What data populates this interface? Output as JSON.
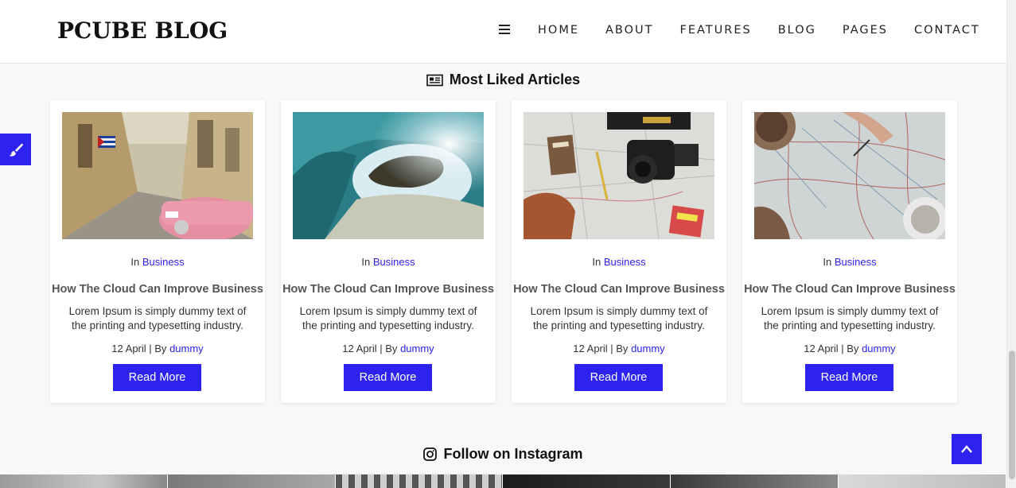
{
  "header": {
    "logo": "PCUBE BLOG",
    "nav": [
      "HOME",
      "ABOUT",
      "FEATURES",
      "BLOG",
      "PAGES",
      "CONTACT"
    ]
  },
  "sections": {
    "most_liked": "Most Liked Articles",
    "instagram": "Follow on Instagram"
  },
  "cards": [
    {
      "cat_prefix": "In",
      "category": "Business",
      "title": "How The Cloud Can Improve Business",
      "excerpt": "Lorem Ipsum is simply dummy text of the printing and typesetting industry.",
      "date": "12 April | By",
      "author": "dummy",
      "button": "Read More",
      "image": "street-pink-car"
    },
    {
      "cat_prefix": "In",
      "category": "Business",
      "title": "How The Cloud Can Improve Business",
      "excerpt": "Lorem Ipsum is simply dummy text of the printing and typesetting industry.",
      "date": "12 April | By",
      "author": "dummy",
      "button": "Read More",
      "image": "ocean-wave"
    },
    {
      "cat_prefix": "In",
      "category": "Business",
      "title": "How The Cloud Can Improve Business",
      "excerpt": "Lorem Ipsum is simply dummy text of the printing and typesetting industry.",
      "date": "12 April | By",
      "author": "dummy",
      "button": "Read More",
      "image": "travel-camera-map"
    },
    {
      "cat_prefix": "In",
      "category": "Business",
      "title": "How The Cloud Can Improve Business",
      "excerpt": "Lorem Ipsum is simply dummy text of the printing and typesetting industry.",
      "date": "12 April | By",
      "author": "dummy",
      "button": "Read More",
      "image": "map-coffee"
    }
  ],
  "icons": {
    "menu": "hamburger-icon",
    "side": "paintbrush-icon",
    "section1": "newspaper-icon",
    "section2": "instagram-icon",
    "totop": "chevron-up-icon"
  },
  "colors": {
    "accent": "#2d22f0",
    "background": "#f8f8f8",
    "card": "#ffffff",
    "text": "#333333"
  }
}
